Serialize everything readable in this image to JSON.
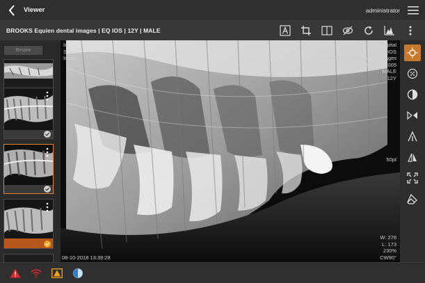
{
  "app": {
    "title": "Viewer",
    "user": "administrator"
  },
  "patient": {
    "header": "BROOKS Equien dental images | EQ IOS | 12Y | MALE"
  },
  "toolbar": {
    "icons": [
      "annotation-icon",
      "crop-icon",
      "split-view-icon",
      "hide-icon",
      "rotate-icon",
      "histogram-icon",
      "more-options-icon"
    ]
  },
  "thumbnails": {
    "retake_label": "Retake",
    "items": [
      {
        "selected": false,
        "status": "done"
      },
      {
        "selected": false,
        "status": "done"
      },
      {
        "selected": true,
        "status": "done"
      },
      {
        "selected": false,
        "status": "warning"
      }
    ]
  },
  "overlay": {
    "top_left": [
      "Id:",
      "Sex:",
      "Imag"
    ],
    "top_right": [
      "Hospital",
      "EQ IOS",
      "BROOKS Equien dental images",
      "DOB 08-15-2005",
      "MALE",
      "12Y"
    ],
    "scale_label": "50pt",
    "bottom_right": [
      "W: 276",
      "L: 173",
      "230%",
      "CW90°"
    ],
    "timestamp": "08-10-2018 13:39:28"
  },
  "right_tools": [
    "brightness-icon",
    "sharpen-icon",
    "contrast-icon",
    "flip-horizontal-icon",
    "calibration-icon",
    "flip-vertical-icon",
    "fit-to-screen-icon",
    "eraser-icon"
  ],
  "status_icons": [
    "alert-icon",
    "wifi-error-icon",
    "warning-icon",
    "sensor-status-icon"
  ],
  "colors": {
    "accent": "#c87a2c",
    "alert": "#e0262b",
    "warning": "#f2a51a"
  }
}
